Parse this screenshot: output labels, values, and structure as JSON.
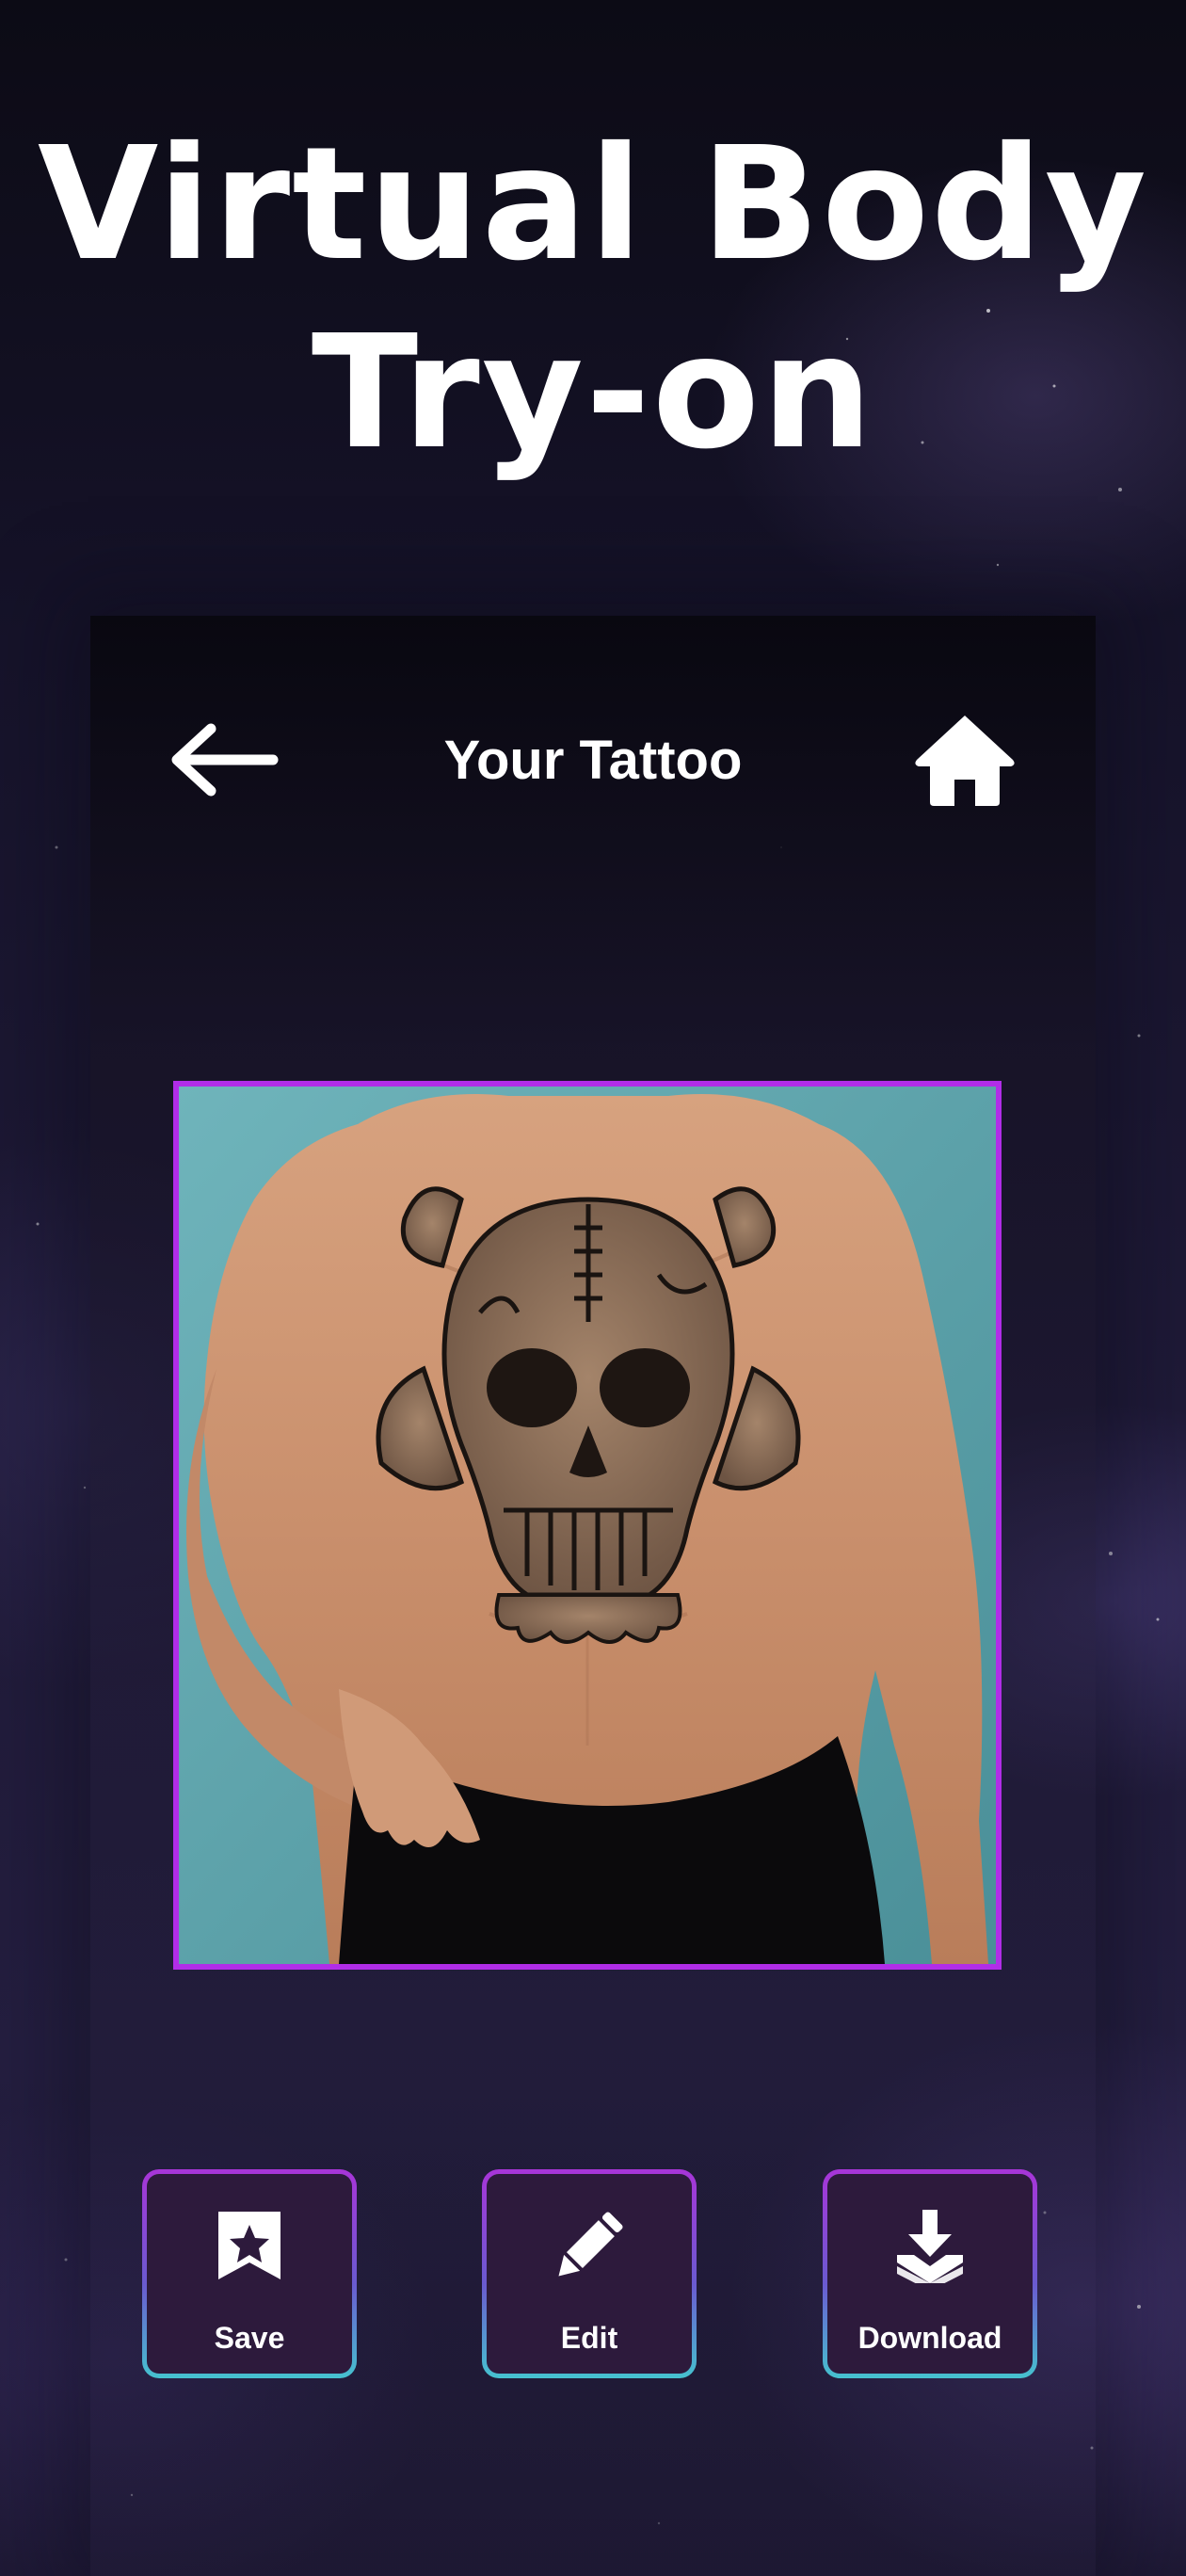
{
  "promo": {
    "headline_line1": "Virtual Body",
    "headline_line2": "Try-on"
  },
  "header": {
    "title": "Your Tattoo",
    "back_icon": "arrow-left-icon",
    "home_icon": "home-icon"
  },
  "preview": {
    "frame_color": "#b12de8"
  },
  "actions": [
    {
      "label": "Save",
      "icon": "bookmark-star-icon"
    },
    {
      "label": "Edit",
      "icon": "pencil-icon"
    },
    {
      "label": "Download",
      "icon": "download-tray-icon"
    }
  ],
  "colors": {
    "accent": "#b12de8",
    "button_fill": "#2d1a3c",
    "button_border_bottom": "#46c2cf"
  }
}
